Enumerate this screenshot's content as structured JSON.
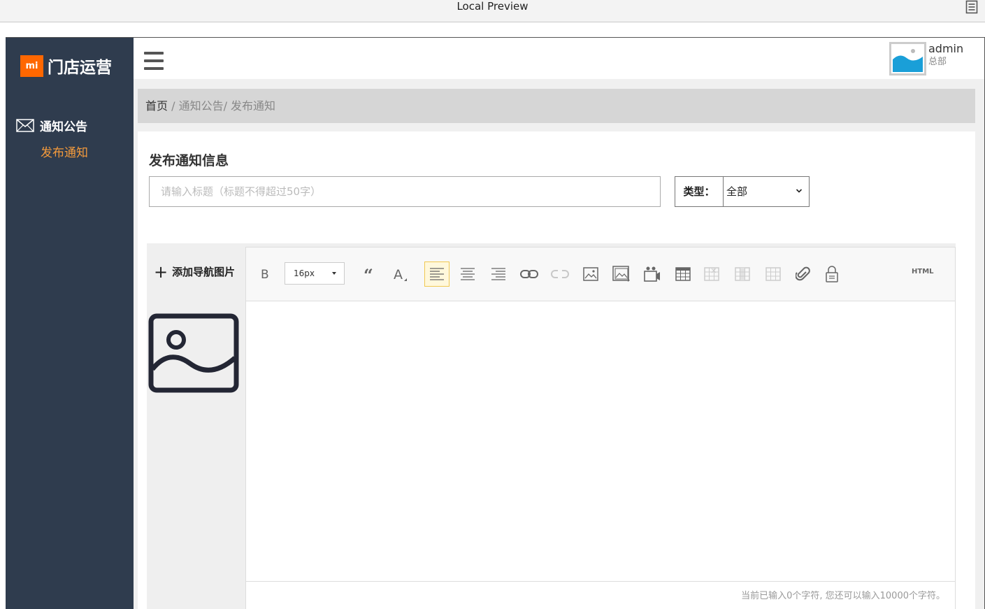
{
  "window": {
    "title": "Local Preview",
    "menu_icon": "document-menu-icon"
  },
  "brand": {
    "logo_text": "mi",
    "name": "门店运营",
    "logo_color": "#ff6700"
  },
  "sidebar": {
    "background": "#2f3c4e",
    "group": {
      "icon": "mail-icon",
      "label": "通知公告"
    },
    "active_item": {
      "label": "发布通知",
      "color": "#f39a3c"
    }
  },
  "user": {
    "name": "admin",
    "role": "总部",
    "avatar_icon": "image-avatar-icon"
  },
  "breadcrumb": {
    "home": "首页",
    "rest": " / 通知公告/ 发布通知"
  },
  "form": {
    "heading": "发布通知信息",
    "title_placeholder": "请输入标题（标题不得超过50字）",
    "type_label": "类型：",
    "type_value": "全部"
  },
  "nav_image": {
    "add_label": "添加导航图片",
    "placeholder_icon": "image-placeholder-icon"
  },
  "editor": {
    "font_size": "16px",
    "html_label": "HTML",
    "toolbar_icons": [
      "bold-icon",
      "quote-icon",
      "font-color-icon",
      "align-left-icon",
      "align-center-icon",
      "align-right-icon",
      "link-icon",
      "unlink-icon",
      "image-icon",
      "multi-image-icon",
      "video-icon",
      "insert-table-icon",
      "delete-table-icon",
      "insert-row-icon",
      "insert-col-icon",
      "attachment-icon",
      "lock-icon"
    ],
    "status_text": "当前已输入0个字符, 您还可以输入10000个字符。"
  }
}
